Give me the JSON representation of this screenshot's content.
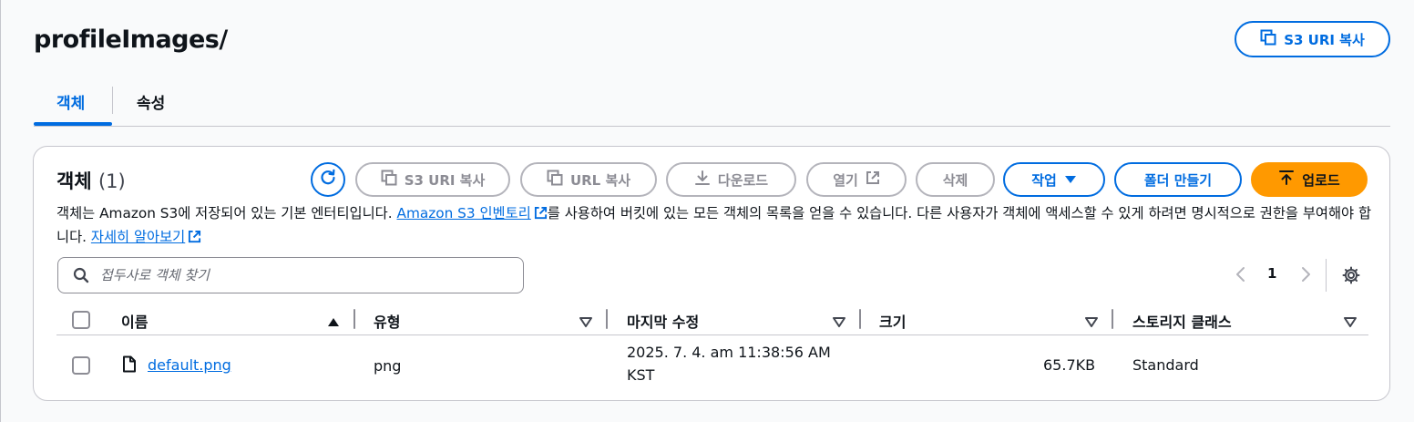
{
  "page": {
    "title": "profileImages/",
    "copy_s3_uri_label": "S3 URI 복사"
  },
  "tabs": [
    {
      "label": "객체",
      "active": true
    },
    {
      "label": "속성",
      "active": false
    }
  ],
  "panel": {
    "title": "객체",
    "count": "(1)",
    "buttons": {
      "copy_s3_uri": "S3 URI 복사",
      "copy_url": "URL 복사",
      "download": "다운로드",
      "open": "열기",
      "delete": "삭제",
      "actions": "작업",
      "create_folder": "폴더 만들기",
      "upload": "업로드"
    },
    "description": {
      "part1": "객체는 Amazon S3에 저장되어 있는 기본 엔터티입니다. ",
      "inventory_link": "Amazon S3 인벤토리",
      "part2": "를 사용하여 버킷에 있는 모든 객체의 목록을 얻을 수 있습니다. 다른 사용자가 객체에 액세스할 수 있게 하려면 명시적으로 권한을 부여해야 합니다. ",
      "learn_more_link": "자세히 알아보기"
    },
    "search": {
      "placeholder": "접두사로 객체 찾기",
      "value": ""
    },
    "pagination": {
      "current_page": "1"
    }
  },
  "table": {
    "columns": [
      {
        "label": "이름",
        "sort": "ascending"
      },
      {
        "label": "유형",
        "sort": "none"
      },
      {
        "label": "마지막 수정",
        "sort": "none"
      },
      {
        "label": "크기",
        "sort": "none"
      },
      {
        "label": "스토리지 클래스",
        "sort": "none"
      }
    ],
    "rows": [
      {
        "name": "default.png",
        "icon": "file-icon",
        "type": "png",
        "last_modified_line1": "2025. 7. 4. am 11:38:56 AM",
        "last_modified_line2": "KST",
        "size": "65.7KB",
        "storage_class": "Standard"
      }
    ]
  },
  "colors": {
    "accent": "#006ce0",
    "upload": "#ff9900",
    "disabled_border": "#b4b4bb",
    "text": "#0f141a"
  }
}
